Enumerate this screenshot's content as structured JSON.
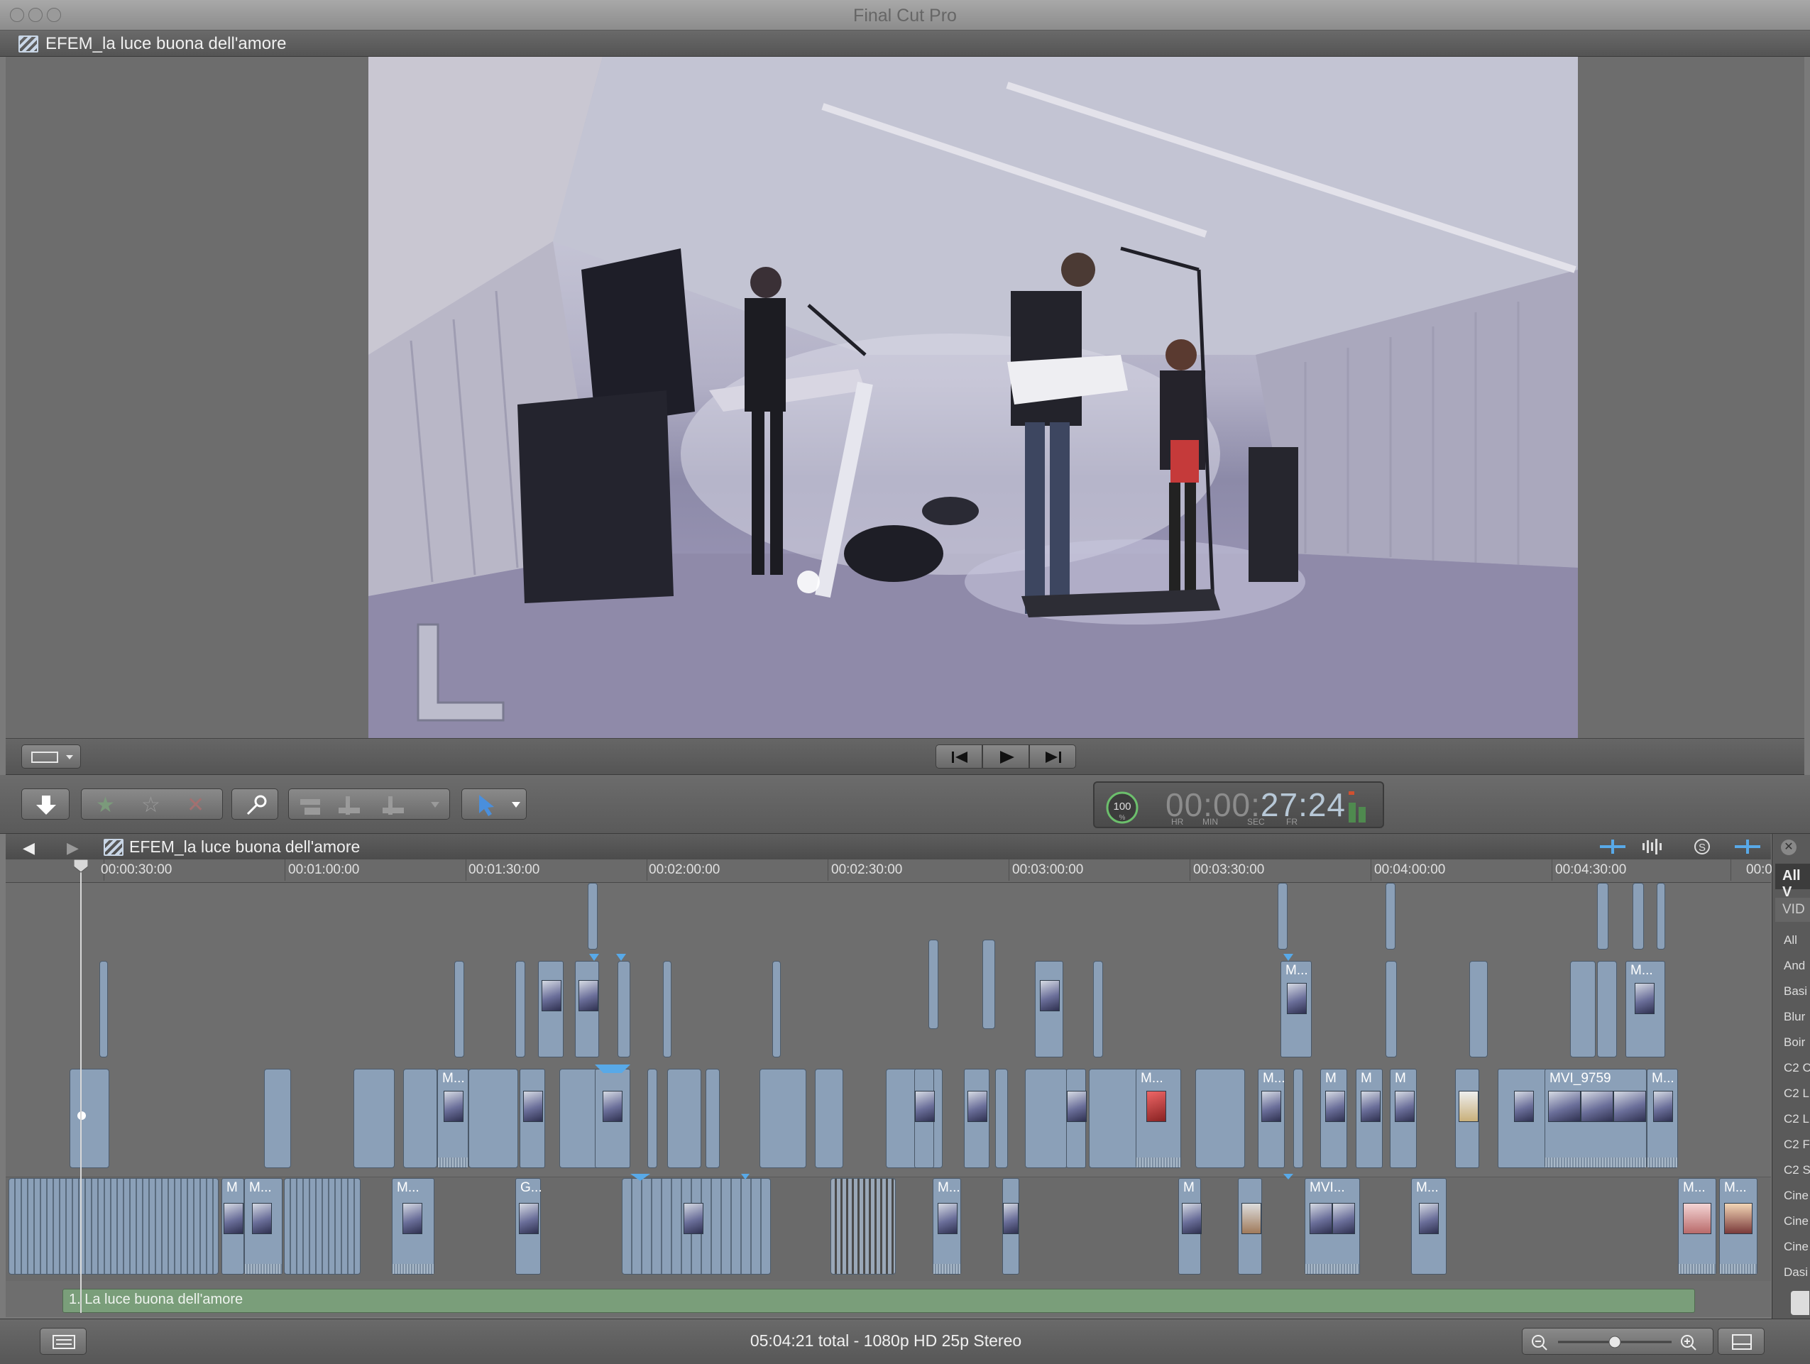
{
  "app": {
    "title": "Final Cut Pro"
  },
  "viewer": {
    "project_title": "EFEM_la luce buona dell'amore"
  },
  "timecode": {
    "value_dim": "00:00:",
    "value_bright": "27:24",
    "labels": [
      "HR",
      "MIN",
      "SEC",
      "FR"
    ],
    "dial": "100",
    "dial_unit": "%"
  },
  "timeline": {
    "project_title": "EFEM_la luce buona dell'amore",
    "ruler": [
      "00:00:30:00",
      "00:01:00:00",
      "00:01:30:00",
      "00:02:00:00",
      "00:02:30:00",
      "00:03:00:00",
      "00:03:30:00",
      "00:04:00:00",
      "00:04:30:00",
      "00:0"
    ],
    "clip_labels": {
      "mvi9759": "MVI_9759",
      "m": "M...",
      "m_short": "M",
      "mvi": "MVI...",
      "g": "G..."
    },
    "audio_track": "1. La luce buona dell'amore"
  },
  "index": {
    "filter": "All V",
    "section": "VID",
    "items": [
      "All",
      "And",
      "Basi",
      "Blur",
      "Boir",
      "C2 C",
      "C2 L",
      "C2 L",
      "C2 F",
      "C2 S",
      "Cine",
      "Cine",
      "Cine",
      "Dasi"
    ]
  },
  "status": {
    "info": "05:04:21 total - 1080p HD 25p Stereo"
  },
  "colors": {
    "clip": "#8ba0b8",
    "audio": "#7a9e7a",
    "accent": "#58a9e8"
  }
}
